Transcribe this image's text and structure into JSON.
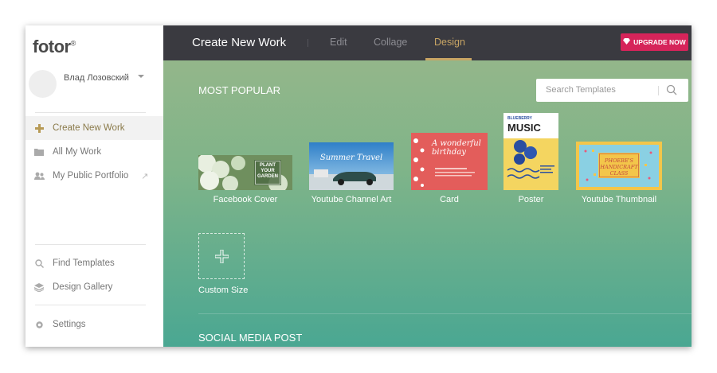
{
  "sidebar": {
    "logo": "fotor",
    "logo_mark": "®",
    "user": {
      "name": "Влад Лозовский"
    },
    "nav_top": [
      {
        "label": "Create New Work",
        "icon": "plus-icon",
        "active": true
      },
      {
        "label": "All My Work",
        "icon": "folder-icon"
      },
      {
        "label": "My Public Portfolio",
        "icon": "users-icon"
      }
    ],
    "nav_bottom": [
      {
        "label": "Find Templates",
        "icon": "search-icon"
      },
      {
        "label": "Design Gallery",
        "icon": "layers-icon"
      }
    ],
    "settings": {
      "label": "Settings",
      "icon": "gear-icon"
    }
  },
  "topbar": {
    "title": "Create New Work",
    "tabs": [
      {
        "label": "Edit"
      },
      {
        "label": "Collage"
      },
      {
        "label": "Design",
        "active": true
      }
    ],
    "upgrade_label": "UPGRADE NOW"
  },
  "main": {
    "section_popular": "MOST POPULAR",
    "search": {
      "placeholder": "Search Templates"
    },
    "templates": [
      {
        "label": "Facebook Cover",
        "thumb_text": "PLANT YOUR GARDEN"
      },
      {
        "label": "Youtube Channel Art",
        "thumb_text": "Summer Travel"
      },
      {
        "label": "Card",
        "thumb_text": "A wonderful birthday"
      },
      {
        "label": "Poster",
        "thumb_text": "MUSIC",
        "thumb_subtext": "BLUEBERRY"
      },
      {
        "label": "Youtube Thumbnail",
        "thumb_text": "PHOEBE'S HANDICRAFT CLASS"
      }
    ],
    "custom_size_label": "Custom Size",
    "section_social": "SOCIAL MEDIA POST"
  },
  "colors": {
    "accent": "#c8a564",
    "upgrade": "#d6245a",
    "topbar": "#3a3a40"
  }
}
